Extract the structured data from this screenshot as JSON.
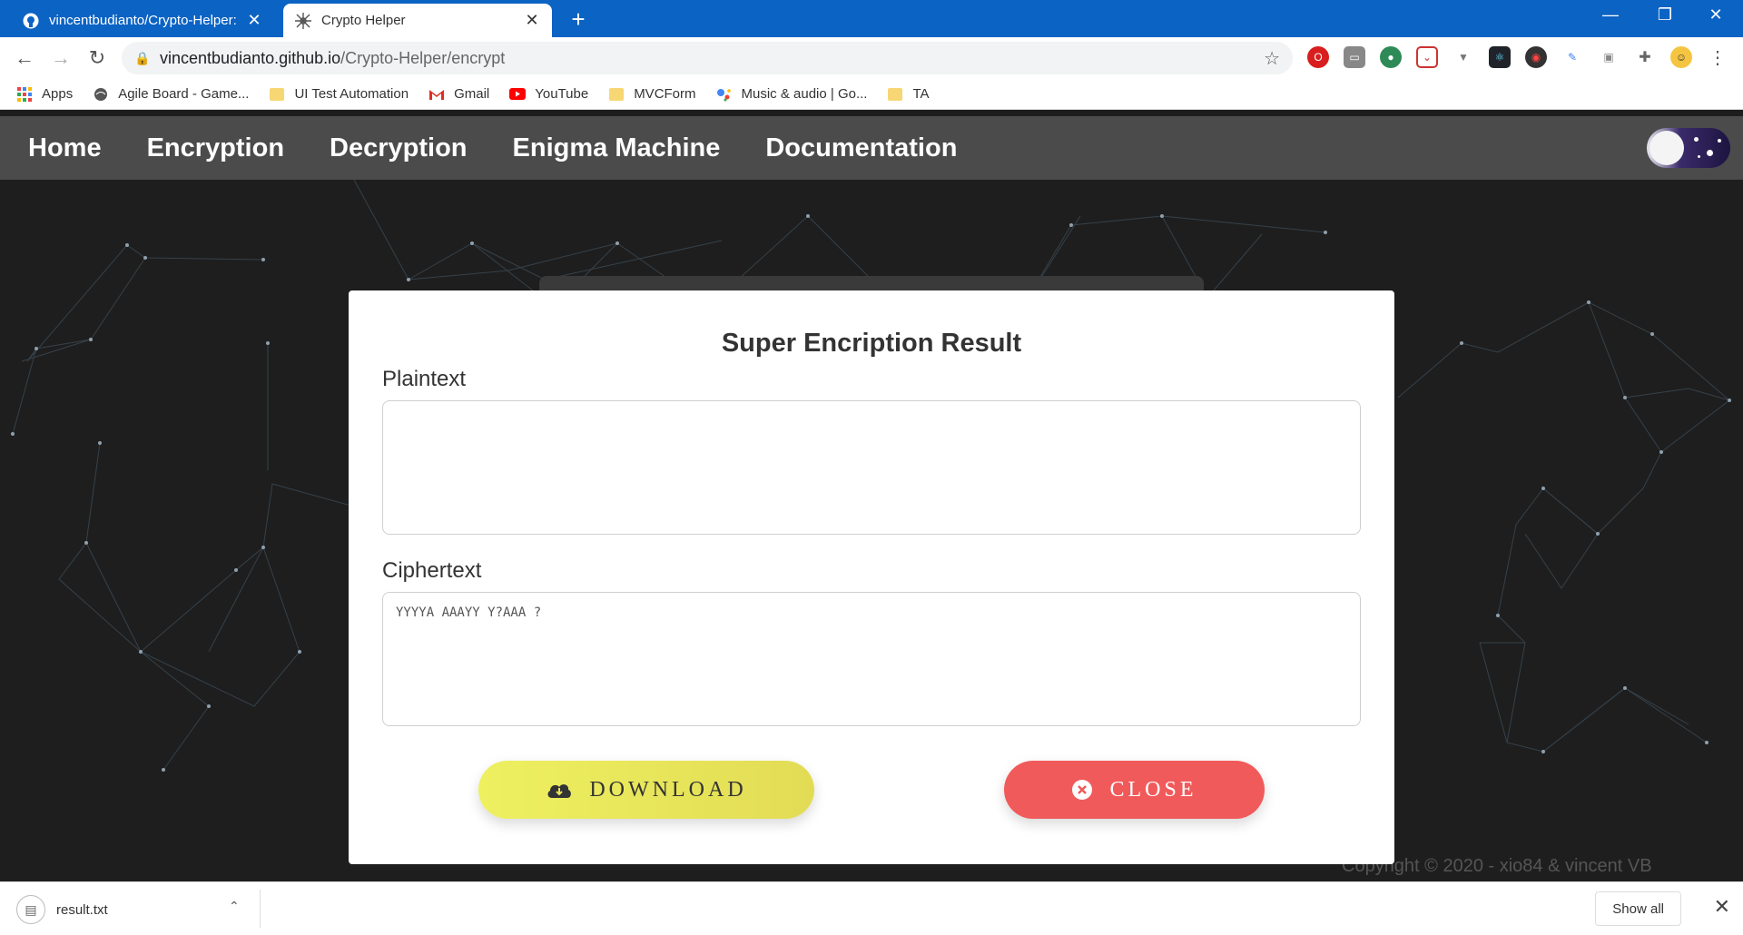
{
  "browser": {
    "tabs": [
      {
        "title": "vincentbudianto/Crypto-Helper: ",
        "icon": "github-icon",
        "active": false
      },
      {
        "title": "Crypto Helper",
        "icon": "crypto-helper-favicon",
        "active": true
      }
    ],
    "new_tab": "+",
    "window_controls": {
      "minimize": "—",
      "restore": "❐",
      "close": "✕"
    },
    "url_host": "vincentbudianto.github.io",
    "url_path": "/Crypto-Helper/encrypt",
    "bookmarks": [
      {
        "label": "Apps",
        "icon": "apps-grid-icon"
      },
      {
        "label": "Agile Board - Game...",
        "icon": "globe-icon"
      },
      {
        "label": "UI Test Automation",
        "icon": "folder-icon"
      },
      {
        "label": "Gmail",
        "icon": "gmail-icon"
      },
      {
        "label": "YouTube",
        "icon": "youtube-icon"
      },
      {
        "label": "MVCForm",
        "icon": "folder-icon"
      },
      {
        "label": "Music & audio | Go...",
        "icon": "google-assistant-icon"
      },
      {
        "label": "TA",
        "icon": "folder-icon"
      }
    ]
  },
  "site": {
    "nav": [
      "Home",
      "Encryption",
      "Decryption",
      "Enigma Machine",
      "Documentation"
    ],
    "footer": "Copyright © 2020 - xio84 & vincent VB"
  },
  "modal": {
    "title": "Super Encription Result",
    "plaintext_label": "Plaintext",
    "plaintext_value": "",
    "ciphertext_label": "Ciphertext",
    "ciphertext_value": "YYYYA AAAYY Y?AAA ?",
    "download_label": "DOWNLOAD",
    "close_label": "CLOSE"
  },
  "download_shelf": {
    "file_name": "result.txt",
    "show_all": "Show all"
  }
}
